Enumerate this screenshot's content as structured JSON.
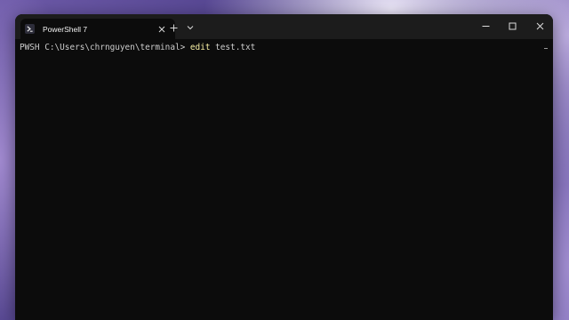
{
  "tab": {
    "title": "PowerShell 7",
    "icon": "powershell-icon",
    "close_icon": "close-icon"
  },
  "titlebar": {
    "new_tab_icon": "plus-icon",
    "dropdown_icon": "chevron-down-icon",
    "minimize_icon": "minimize-icon",
    "maximize_icon": "maximize-icon",
    "close_icon": "close-icon"
  },
  "terminal": {
    "prompt": "PWSH C:\\Users\\chrnguyen\\terminal> ",
    "command": "edit",
    "arguments": " test.txt"
  },
  "colors": {
    "background": "#0c0c0c",
    "titlebar": "#1c1c1c",
    "command_highlight": "#f9f1a5"
  }
}
